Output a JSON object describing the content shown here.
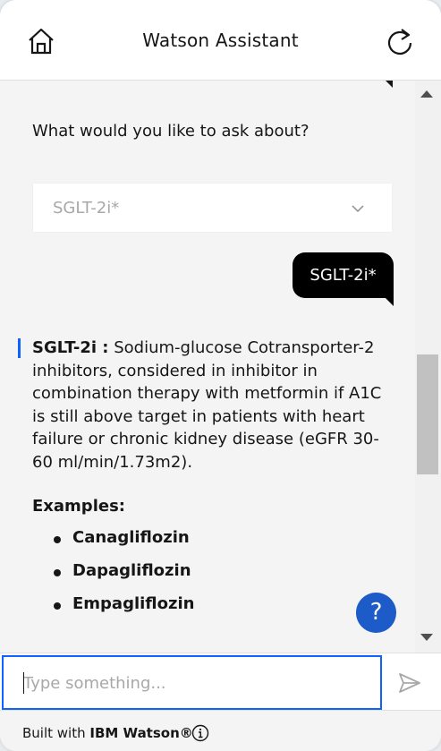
{
  "header": {
    "title": "Watson Assistant",
    "home_icon": "home-icon",
    "restart_icon": "restart-icon"
  },
  "conversation": {
    "bot_question": "What would you like to ask about?",
    "dropdown": {
      "selected": "SGLT-2i*",
      "icon": "chevron-down-icon"
    },
    "user_message": "SGLT-2i*",
    "info": {
      "term": "SGLT-2i :",
      "description": " Sodium-glucose Cotransporter-2 inhibitors, considered in inhibitor in combination therapy with metformin if A1C is still above target in patients with heart failure or chronic kidney disease (eGFR 30-60 ml/min/1.73m2)."
    },
    "examples_heading": "Examples:",
    "examples": [
      "Canagliflozin",
      "Dapagliflozin",
      "Empagliflozin"
    ]
  },
  "help_button": {
    "label": "?"
  },
  "input": {
    "placeholder": "Type something...",
    "value": "",
    "send_icon": "send-icon"
  },
  "footer": {
    "built_with": "Built with",
    "brand": "IBM Watson®",
    "info_icon": "info-icon"
  },
  "colors": {
    "accent": "#0f62fe",
    "help": "#1d5bc8",
    "bubble": "#000000",
    "background": "#f4f4f4"
  }
}
